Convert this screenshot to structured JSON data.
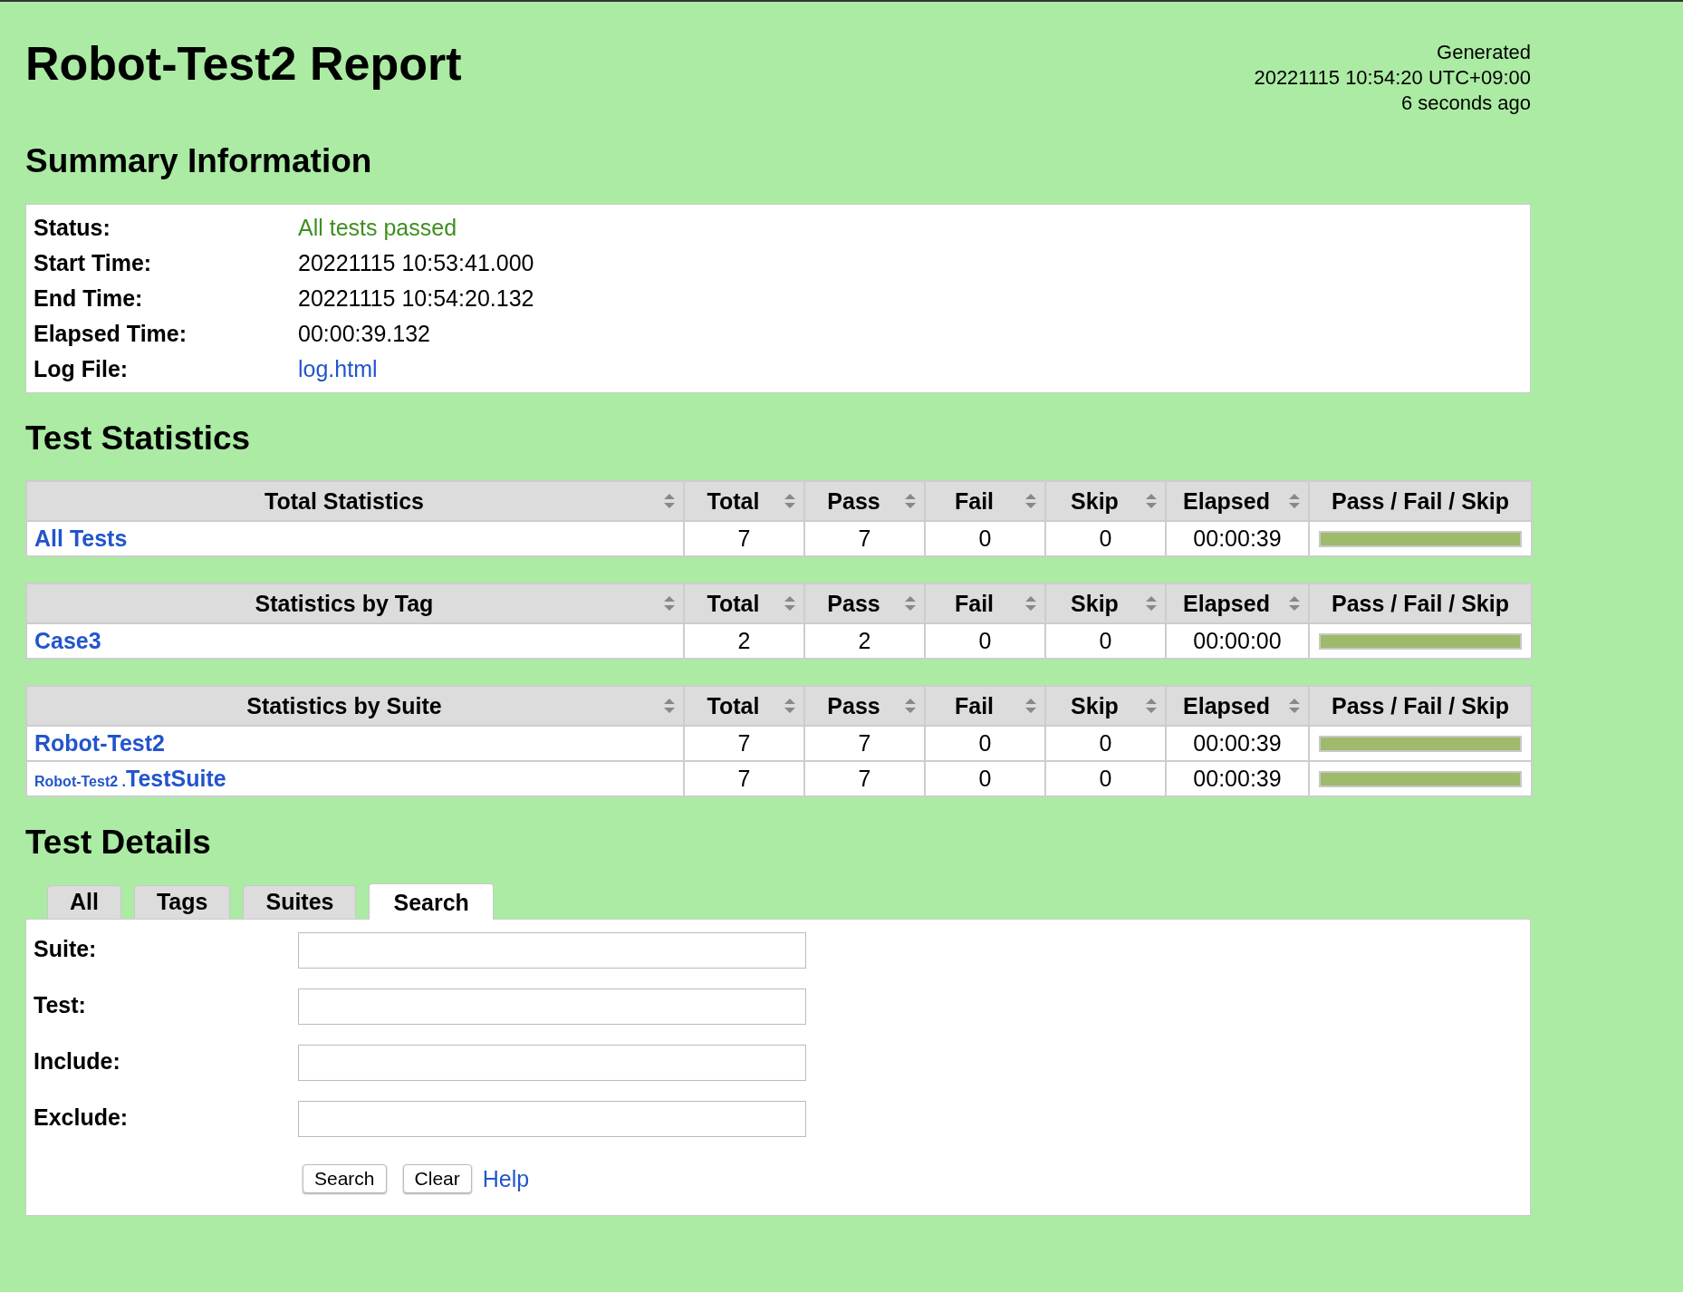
{
  "title": "Robot-Test2 Report",
  "generated": [
    "Generated",
    "20221115 10:54:20 UTC+09:00",
    "6 seconds ago"
  ],
  "summary": {
    "heading": "Summary Information",
    "rows": [
      {
        "label": "Status:",
        "value": "All tests passed",
        "kind": "status"
      },
      {
        "label": "Start Time:",
        "value": "20221115 10:53:41.000",
        "kind": "text"
      },
      {
        "label": "End Time:",
        "value": "20221115 10:54:20.132",
        "kind": "text"
      },
      {
        "label": "Elapsed Time:",
        "value": "00:00:39.132",
        "kind": "text"
      },
      {
        "label": "Log File:",
        "value": "log.html",
        "kind": "link"
      }
    ]
  },
  "statistics": {
    "heading": "Test Statistics",
    "tables": [
      {
        "columns": [
          {
            "label": "Total Statistics",
            "sortable": true
          },
          {
            "label": "Total",
            "sortable": true
          },
          {
            "label": "Pass",
            "sortable": true
          },
          {
            "label": "Fail",
            "sortable": true
          },
          {
            "label": "Skip",
            "sortable": true
          },
          {
            "label": "Elapsed",
            "sortable": true
          },
          {
            "label": "Pass / Fail / Skip",
            "sortable": false
          }
        ],
        "rows": [
          {
            "name": "All Tests",
            "total": "7",
            "pass": "7",
            "fail": "0",
            "skip": "0",
            "elapsed": "00:00:39",
            "level": 1
          }
        ]
      },
      {
        "columns": [
          {
            "label": "Statistics by Tag",
            "sortable": true
          },
          {
            "label": "Total",
            "sortable": true
          },
          {
            "label": "Pass",
            "sortable": true
          },
          {
            "label": "Fail",
            "sortable": true
          },
          {
            "label": "Skip",
            "sortable": true
          },
          {
            "label": "Elapsed",
            "sortable": true
          },
          {
            "label": "Pass / Fail / Skip",
            "sortable": false
          }
        ],
        "rows": [
          {
            "name": "Case3",
            "total": "2",
            "pass": "2",
            "fail": "0",
            "skip": "0",
            "elapsed": "00:00:00",
            "level": 1
          }
        ]
      },
      {
        "columns": [
          {
            "label": "Statistics by Suite",
            "sortable": true
          },
          {
            "label": "Total",
            "sortable": true
          },
          {
            "label": "Pass",
            "sortable": true
          },
          {
            "label": "Fail",
            "sortable": true
          },
          {
            "label": "Skip",
            "sortable": true
          },
          {
            "label": "Elapsed",
            "sortable": true
          },
          {
            "label": "Pass / Fail / Skip",
            "sortable": false
          }
        ],
        "rows": [
          {
            "name": "Robot-Test2",
            "total": "7",
            "pass": "7",
            "fail": "0",
            "skip": "0",
            "elapsed": "00:00:39",
            "level": 1
          },
          {
            "parent": "Robot-Test2 .",
            "name": "TestSuite",
            "total": "7",
            "pass": "7",
            "fail": "0",
            "skip": "0",
            "elapsed": "00:00:39",
            "level": 1
          }
        ]
      }
    ]
  },
  "details": {
    "heading": "Test Details",
    "tabs": [
      {
        "label": "All",
        "selected": false
      },
      {
        "label": "Tags",
        "selected": false
      },
      {
        "label": "Suites",
        "selected": false
      },
      {
        "label": "Search",
        "selected": true
      }
    ],
    "fields": [
      {
        "label": "Suite:"
      },
      {
        "label": "Test:"
      },
      {
        "label": "Include:"
      },
      {
        "label": "Exclude:"
      }
    ],
    "buttons": [
      "Search",
      "Clear"
    ],
    "help": "Help"
  }
}
